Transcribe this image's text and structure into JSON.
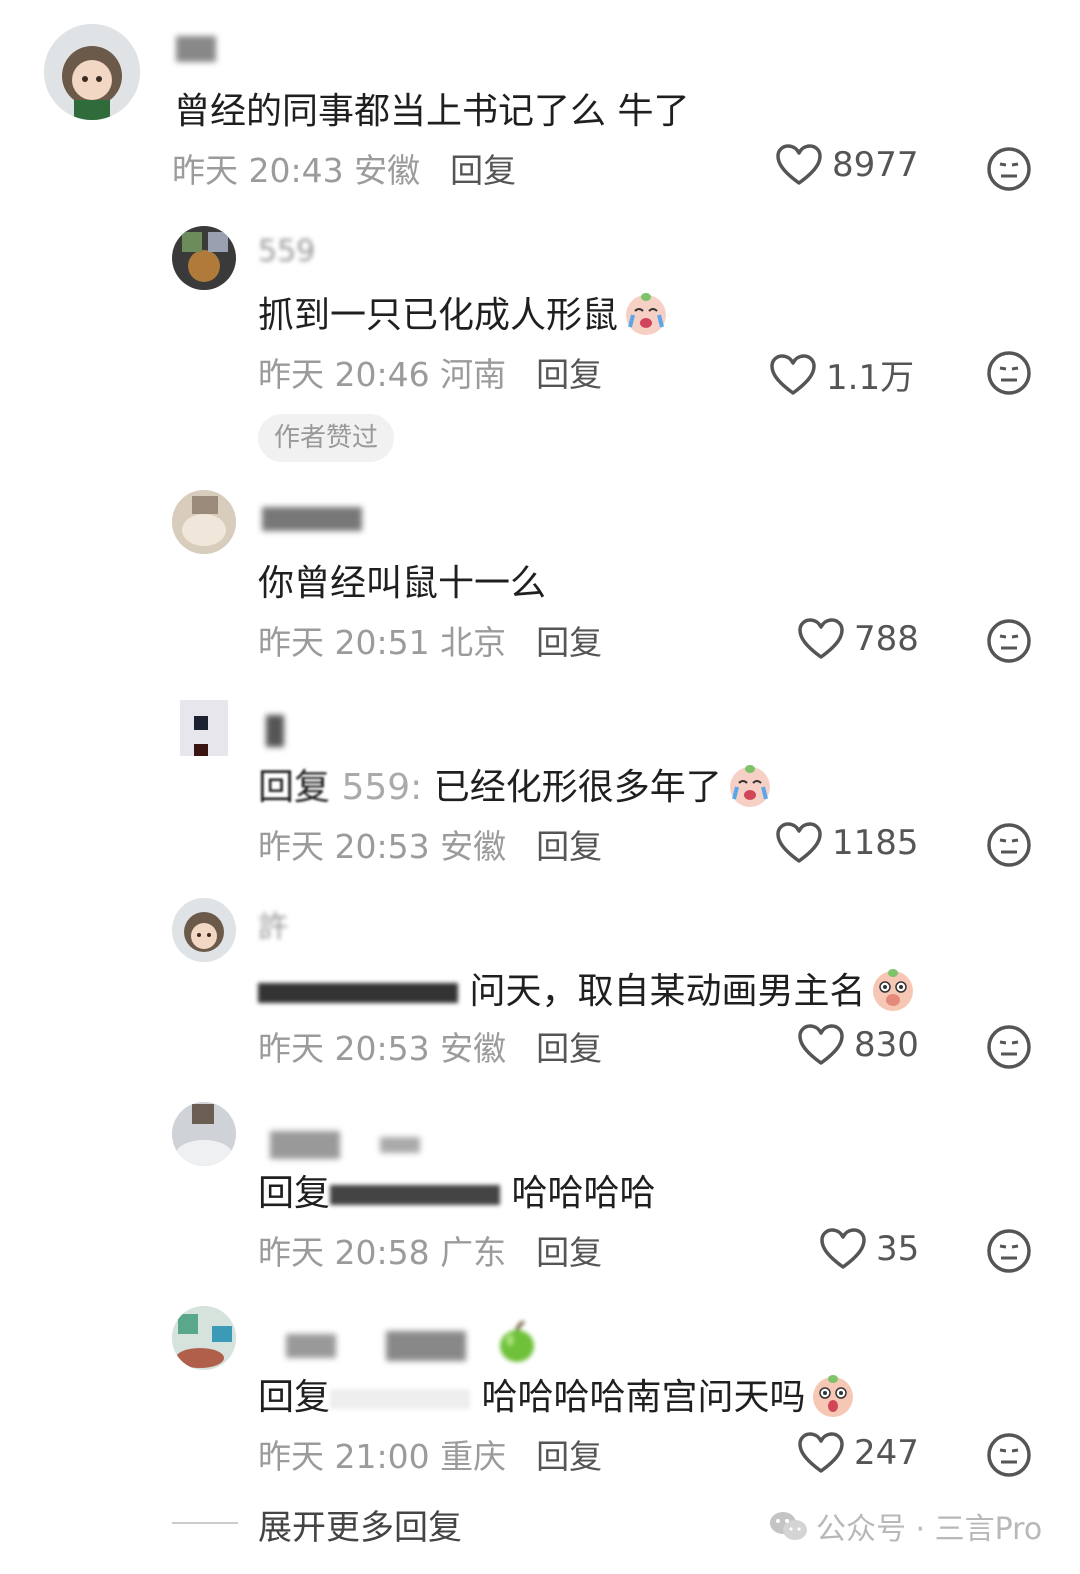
{
  "comments": [
    {
      "text": "曾经的同事都当上书记了么 牛了",
      "meta": "昨天 20:43 安徽",
      "reply": "回复",
      "likes": "8977"
    },
    {
      "name": "559",
      "text": "抓到一只已化成人形鼠",
      "meta": "昨天 20:46 河南",
      "reply": "回复",
      "likes": "1.1万",
      "badge": "作者赞过"
    },
    {
      "text": "你曾经叫鼠十一么",
      "meta": "昨天 20:51 北京",
      "reply": "回复",
      "likes": "788"
    },
    {
      "text_prefix": "回复",
      "text_mention": "559:",
      "text": "已经化形很多年了",
      "meta": "昨天 20:53 安徽",
      "reply": "回复",
      "likes": "1185"
    },
    {
      "name": "許",
      "text": "问天，取自某动画男主名",
      "meta": "昨天 20:53 安徽",
      "reply": "回复",
      "likes": "830"
    },
    {
      "text_prefix": "回复",
      "text": "哈哈哈哈",
      "meta": "昨天 20:58 广东",
      "reply": "回复",
      "likes": "35"
    },
    {
      "text_prefix": "回复",
      "text": "哈哈哈哈南宫问天吗",
      "meta": "昨天 21:00 重庆",
      "reply": "回复",
      "likes": "247"
    }
  ],
  "footer": {
    "more_replies": "展开更多回复",
    "watermark": "公众号 · 三言Pro"
  },
  "colors": {
    "text": "#1f1f1f",
    "meta": "#9b9b9b",
    "icon": "#555555"
  }
}
